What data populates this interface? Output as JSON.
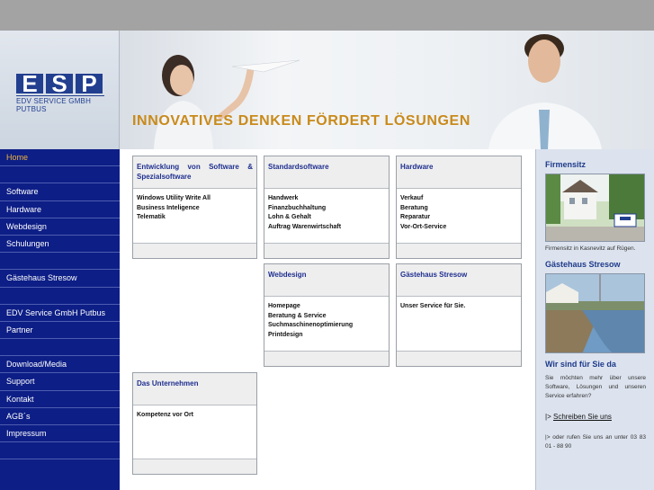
{
  "logo": {
    "letters": [
      "E",
      "S",
      "P"
    ],
    "subtitle": "EDV SERVICE GMBH PUTBUS"
  },
  "banner": {
    "slogan": "INNOVATIVES DENKEN FÖRDERT LÖSUNGEN"
  },
  "nav": [
    {
      "label": "Home",
      "active": true
    },
    {
      "label": ""
    },
    {
      "label": "Software"
    },
    {
      "label": "Hardware"
    },
    {
      "label": "Webdesign"
    },
    {
      "label": "Schulungen"
    },
    {
      "label": ""
    },
    {
      "label": "Gästehaus Stresow"
    },
    {
      "label": ""
    },
    {
      "label": "EDV Service GmbH Putbus"
    },
    {
      "label": "Partner"
    },
    {
      "label": ""
    },
    {
      "label": "Download/Media"
    },
    {
      "label": "Support"
    },
    {
      "label": "Kontakt"
    },
    {
      "label": "AGB´s"
    },
    {
      "label": "Impressum"
    },
    {
      "label": ""
    }
  ],
  "boxes": {
    "entwicklung": {
      "title": "Entwicklung von Software & Spezialsoftware",
      "items": [
        "Windows Utility Write All",
        "Business Inteligence",
        "Telematik"
      ]
    },
    "standard": {
      "title": "Standardsoftware",
      "items": [
        "Handwerk",
        "Finanzbuchhaltung",
        "Lohn & Gehalt",
        "Auftrag Warenwirtschaft"
      ]
    },
    "hardware": {
      "title": "Hardware",
      "items": [
        "Verkauf",
        "Beratung",
        "Reparatur",
        "Vor-Ort-Service"
      ]
    },
    "webdesign": {
      "title": "Webdesign",
      "items": [
        "Homepage",
        "Beratung & Service",
        "Suchmaschinenoptimierung",
        "Printdesign"
      ]
    },
    "gaestehaus": {
      "title": "Gästehaus Stresow",
      "items": [
        "Unser Service für Sie."
      ]
    },
    "unternehmen": {
      "title": "Das Unternehmen",
      "items": [
        "Kompetenz vor Ort"
      ]
    }
  },
  "right": {
    "firmensitz_title": "Firmensitz",
    "firmensitz_caption": "Firmensitz in Kasnevitz auf Rügen.",
    "gaestehaus_title": "Gästehaus Stresow",
    "wir_title": "Wir sind für Sie da",
    "wir_text": "Sie möchten mehr über unsere Software, Lösungen und unseren Service erfahren?",
    "link_prefix": "|> ",
    "link_text": "Schreiben Sie uns",
    "call_text": "|> oder rufen Sie uns an unter 03 83 01 - 88 90"
  },
  "colors": {
    "nav_bg": "#0d1e86",
    "accent_orange": "#c98a1a",
    "link_blue": "#1f2f8f"
  }
}
